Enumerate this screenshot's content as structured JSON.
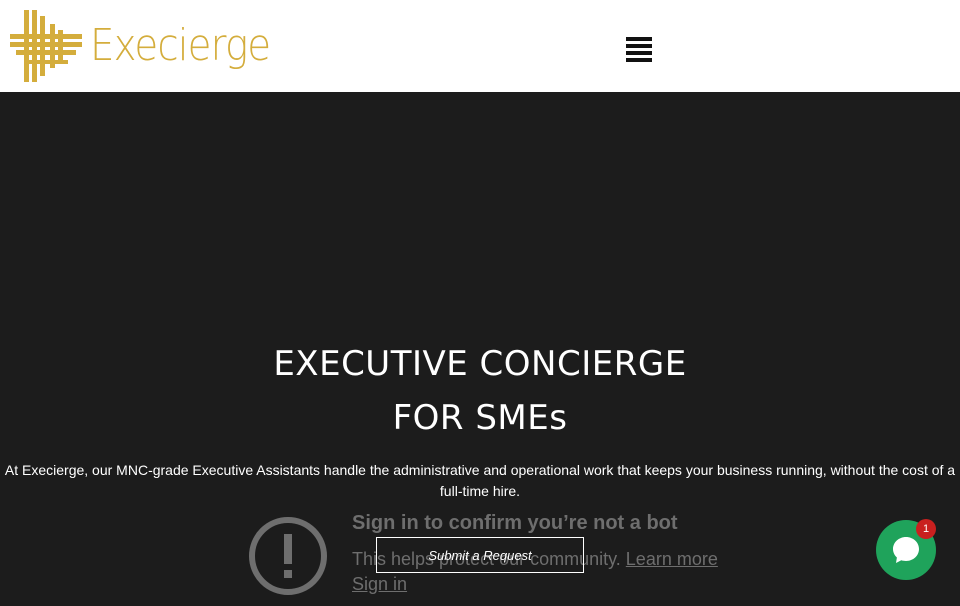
{
  "header": {
    "logo_text": "Execierge",
    "menu_icon": "hamburger-icon"
  },
  "hero": {
    "title_line1": "EXECUTIVE CONCIERGE",
    "title_line2": "FOR SMEs",
    "description": "At Execierge, our MNC-grade Executive Assistants handle the administrative and operational work that keeps your business running, without the cost of a full-time hire.",
    "submit_label": "Submit a Request"
  },
  "bot_check": {
    "icon": "alert-circle-icon",
    "title": "Sign in to confirm you’re not a bot",
    "text": "This helps protect our community.",
    "learn_more": "Learn more",
    "sign_in": "Sign in"
  },
  "chat": {
    "icon": "chat-bubble-icon",
    "badge_count": "1"
  },
  "colors": {
    "brand_gold": "#d4ad3c",
    "hero_bg": "#1c1c1c",
    "chat_green": "#1fa35b",
    "badge_red": "#c9201f"
  }
}
